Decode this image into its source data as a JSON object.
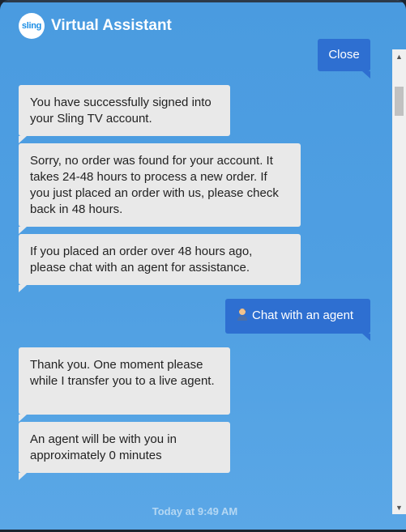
{
  "header": {
    "logo_text": "sling",
    "title": "Virtual Assistant"
  },
  "messages": [
    {
      "from": "user",
      "text": "Close"
    },
    {
      "from": "bot",
      "text": "You have successfully signed into your Sling TV account."
    },
    {
      "from": "bot",
      "text": "Sorry, no order was found for your account. It takes 24-48 hours to process a new order. If you just placed an order with us, please check back in 48 hours."
    },
    {
      "from": "bot",
      "text": "If you placed an order over 48 hours ago, please chat with an agent for assistance."
    },
    {
      "from": "user",
      "text": "Chat with an agent",
      "icon": "person-icon"
    },
    {
      "from": "bot",
      "text": "Thank you. One moment please while I transfer you to a live agent."
    },
    {
      "from": "bot",
      "text": "An agent will be with you in approximately 0 minutes"
    }
  ],
  "timestamp": "Today at 9:49 AM",
  "colors": {
    "background": "#4f9fe2",
    "bot_bubble": "#e9e9e9",
    "user_bubble": "#2e6fd1"
  }
}
